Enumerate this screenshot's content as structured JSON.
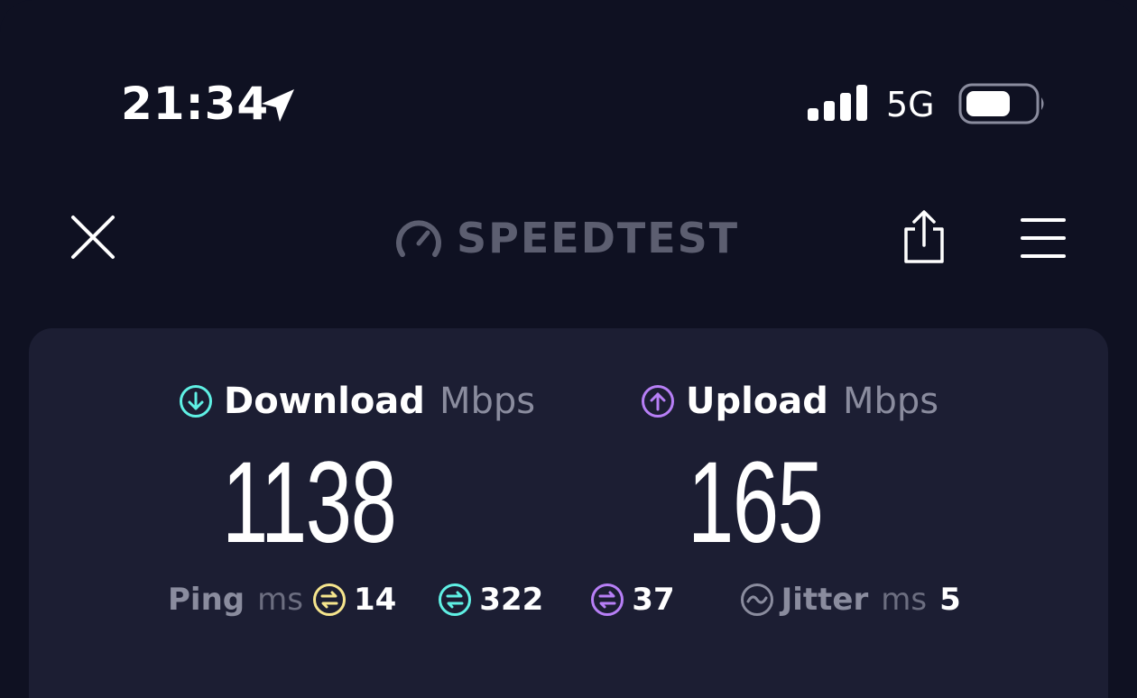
{
  "status_bar": {
    "time": "21:34",
    "network": "5G"
  },
  "toolbar": {
    "brand": "SPEEDTEST"
  },
  "results": {
    "download": {
      "label": "Download",
      "unit": "Mbps",
      "value": "1138",
      "color": "#5ff0e4"
    },
    "upload": {
      "label": "Upload",
      "unit": "Mbps",
      "value": "165",
      "color": "#b77ff6"
    },
    "ping": {
      "label": "Ping",
      "unit": "ms",
      "idle": {
        "value": "14",
        "color": "#f6e58d"
      },
      "download": {
        "value": "322",
        "color": "#5ff0e4"
      },
      "upload": {
        "value": "37",
        "color": "#b77ff6"
      }
    },
    "jitter": {
      "label": "Jitter",
      "unit": "ms",
      "value": "5"
    }
  }
}
